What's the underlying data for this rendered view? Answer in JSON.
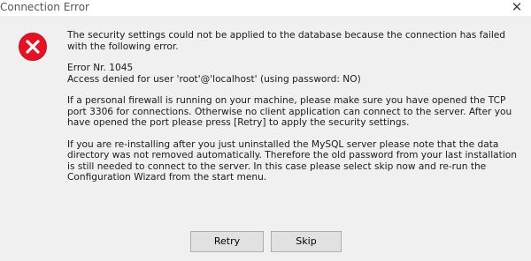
{
  "window": {
    "title": "Connection Error",
    "close_glyph": "✕"
  },
  "icon": {
    "name": "error-icon",
    "color": "#e81123"
  },
  "message": {
    "paragraphs": [
      "The security settings could not be applied to the database because the connection has failed\nwith the following error.",
      "Error Nr. 1045\nAccess denied for user 'root'@'localhost' (using password: NO)",
      "If a personal firewall is running on your machine, please make sure you have opened the TCP\nport 3306 for connections. Otherwise no client application can connect to the server. After you\nhave opened the port please press [Retry] to apply the security settings.",
      "If you are re-installing after you just uninstalled the MySQL server please note that the data\ndirectory was not removed automatically. Therefore the old password from your last installation\nis still needed to connect to the server. In this case please select skip now and re-run the\nConfiguration Wizard from the start menu."
    ]
  },
  "buttons": {
    "retry_label": "Retry",
    "skip_label": "Skip"
  }
}
